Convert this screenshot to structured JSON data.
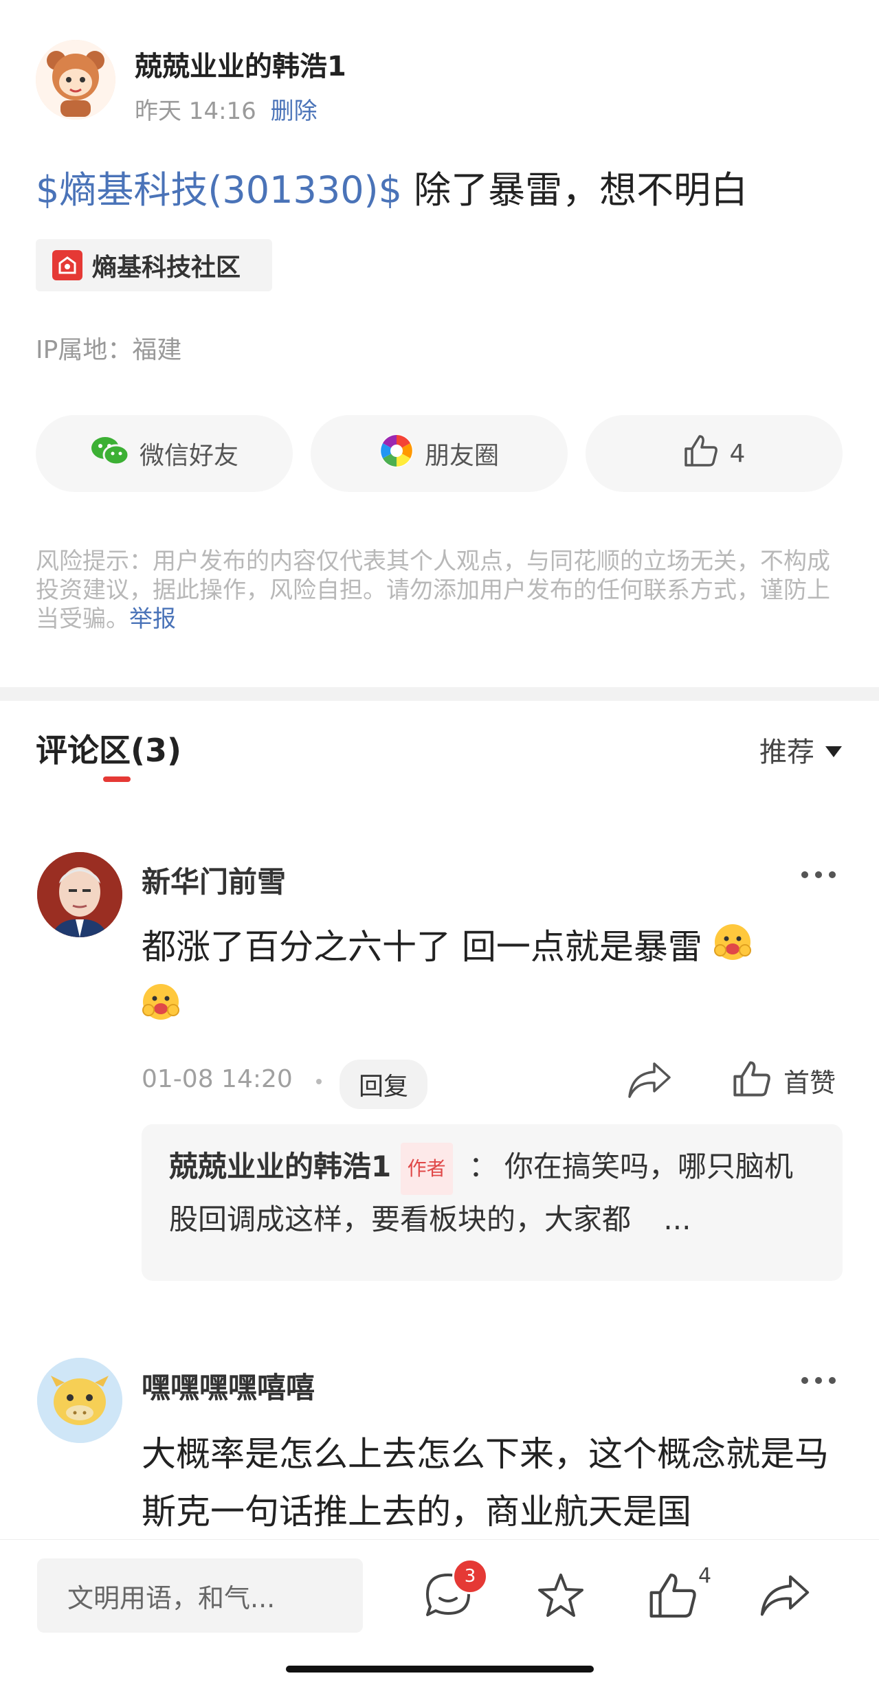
{
  "post": {
    "username": "兢兢业业的韩浩1",
    "time": "昨天 14:16",
    "delete_label": "删除",
    "stock_tag": "$熵基科技(301330)$",
    "content": " 除了暴雷，想不明白",
    "community_label": "熵基科技社区",
    "ip_location": "IP属地：福建"
  },
  "share": {
    "wechat_label": "微信好友",
    "moments_label": "朋友圈",
    "like_count": "4"
  },
  "risk": {
    "text": "风险提示：用户发布的内容仅代表其个人观点，与同花顺的立场无关，不构成投资建议，据此操作，风险自担。请勿添加用户发布的任何联系方式，谨防上当受骗。",
    "report_label": "举报"
  },
  "comments_section": {
    "title": "评论区(3)",
    "sort_label": "推荐"
  },
  "comments": [
    {
      "name": "新华门前雪",
      "text": "都涨了百分之六十了 回一点就是暴雷",
      "time": "01-08 14:20",
      "reply_label": "回复",
      "like_label": "首赞",
      "sub_reply": {
        "name": "兢兢业业的韩浩1",
        "badge": "作者",
        "sep": "：",
        "text": "你在搞笑吗，哪只脑机股回调成这样，要看板块的，大家都",
        "more": "..."
      }
    },
    {
      "name": "嘿嘿嘿嘿嘻嘻",
      "text": "大概率是怎么上去怎么下来，这个概念就是马斯克一句话推上去的，商业航天是国"
    }
  ],
  "bottom_bar": {
    "input_placeholder": "文明用语，和气...",
    "comment_badge": "3",
    "like_count": "4"
  },
  "colors": {
    "link_blue": "#4a73b8",
    "brand_red": "#e53935",
    "wechat_green": "#3cb034"
  },
  "icons": [
    "wechat-icon",
    "moments-icon",
    "thumb-up-icon",
    "share-icon",
    "comment-icon",
    "star-icon",
    "more-icon",
    "community-icon",
    "caret-down-icon"
  ]
}
